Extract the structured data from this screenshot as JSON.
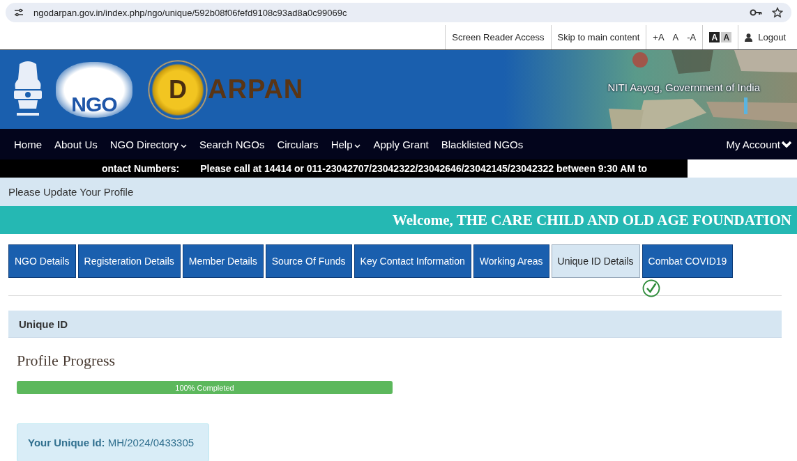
{
  "browser": {
    "url": "ngodarpan.gov.in/index.php/ngo/unique/592b08f06fefd9108c93ad8a0c99069c"
  },
  "utility_bar": {
    "links": [
      "Screen Reader Access",
      "Skip to main content"
    ],
    "font_sizes": [
      "+A",
      "A",
      "-A"
    ],
    "contrast": [
      {
        "label": "A",
        "kind": "dark"
      },
      {
        "label": "A",
        "kind": "light"
      }
    ],
    "logout": "Logout"
  },
  "header": {
    "logo_text": "NGO",
    "brand_letter": "D",
    "brand_rest": "ARPAN",
    "tagline": "NITI Aayog, Government of India"
  },
  "nav": {
    "items": [
      {
        "label": "Home",
        "dropdown": false
      },
      {
        "label": "About Us",
        "dropdown": false
      },
      {
        "label": "NGO Directory",
        "dropdown": true
      },
      {
        "label": "Search NGOs",
        "dropdown": false
      },
      {
        "label": "Circulars",
        "dropdown": false
      },
      {
        "label": "Help",
        "dropdown": true
      },
      {
        "label": "Apply Grant",
        "dropdown": false
      },
      {
        "label": "Blacklisted NGOs",
        "dropdown": false
      }
    ],
    "account": "My Account"
  },
  "ticker": {
    "label": "ontact Numbers:",
    "message": "Please call at 14414 or 011-23042707/23042322/23042646/23042145/23042322 between 9:30 AM to"
  },
  "notice": "Please Update Your Profile",
  "welcome": "Welcome, THE CARE CHILD AND OLD AGE FOUNDATION",
  "tabs": [
    {
      "label": "NGO Details",
      "selected": false,
      "completed": false
    },
    {
      "label": "Registeration Details",
      "selected": false,
      "completed": false
    },
    {
      "label": "Member Details",
      "selected": false,
      "completed": false
    },
    {
      "label": "Source Of Funds",
      "selected": false,
      "completed": false
    },
    {
      "label": "Key Contact Information",
      "selected": false,
      "completed": false
    },
    {
      "label": "Working Areas",
      "selected": false,
      "completed": false
    },
    {
      "label": "Unique ID Details",
      "selected": true,
      "completed": false
    },
    {
      "label": "Combat COVID19",
      "selected": false,
      "completed": true
    }
  ],
  "section": {
    "title": "Unique ID"
  },
  "progress": {
    "title": "Profile Progress",
    "level": 1,
    "reading": "100% Completed"
  },
  "unique_id": {
    "label": "Your Unique Id:",
    "value": "MH/2024/0433305"
  }
}
